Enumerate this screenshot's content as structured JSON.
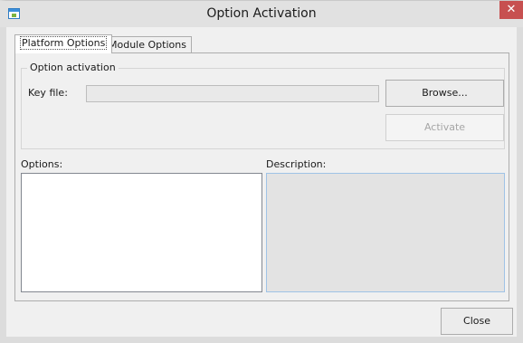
{
  "window": {
    "title": "Option Activation",
    "close_glyph": "✕"
  },
  "tabs": [
    {
      "label": "Platform Options",
      "active": true
    },
    {
      "label": "Module Options",
      "active": false
    }
  ],
  "option_activation": {
    "legend": "Option activation",
    "key_file_label": "Key file:",
    "key_file_value": "",
    "browse_label": "Browse...",
    "activate_label": "Activate",
    "activate_enabled": false
  },
  "options": {
    "label": "Options:",
    "items": []
  },
  "description": {
    "label": "Description:",
    "text": ""
  },
  "footer": {
    "close_label": "Close"
  },
  "colors": {
    "close_button_bg": "#c75050",
    "window_bg": "#f0f0f0",
    "description_bg": "#e3e3e3"
  },
  "icons": {
    "title_icon": "app-window-icon",
    "close_icon": "close-icon"
  }
}
